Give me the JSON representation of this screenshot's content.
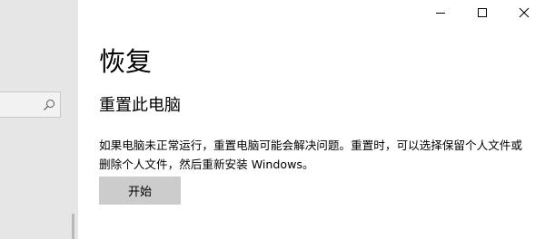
{
  "page": {
    "title": "恢复"
  },
  "reset_section": {
    "title": "重置此电脑",
    "description": "如果电脑未正常运行，重置电脑可能会解决问题。重置时，可以选择保留个人文件或删除个人文件，然后重新安装 Windows。",
    "button_label": "开始"
  },
  "sidebar": {
    "search_icon": "search-icon"
  },
  "window_controls": {
    "minimize_icon": "minimize-icon",
    "maximize_icon": "maximize-icon",
    "close_icon": "close-icon"
  },
  "colors": {
    "sidebar_bg": "#e6e6e6",
    "button_bg": "#cccccc",
    "content_bg": "#ffffff"
  }
}
